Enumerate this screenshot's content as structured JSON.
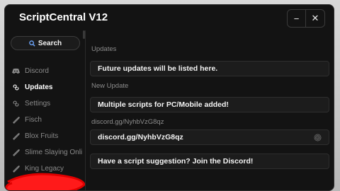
{
  "window": {
    "title": "ScriptCentral V12"
  },
  "controls": {
    "minimize_glyph": "−",
    "close_glyph": "✕"
  },
  "search": {
    "label": "Search"
  },
  "sidebar": {
    "items": [
      {
        "label": "Discord",
        "icon": "discord-icon",
        "active": false
      },
      {
        "label": "Updates",
        "icon": "updates-icon",
        "active": true
      },
      {
        "label": "Settings",
        "icon": "settings-icon",
        "active": false
      },
      {
        "label": "Fisch",
        "icon": "script-icon",
        "active": false
      },
      {
        "label": "Blox Fruits",
        "icon": "script-icon",
        "active": false
      },
      {
        "label": "Slime Slaying Onli",
        "icon": "script-icon",
        "active": false
      },
      {
        "label": "King Legacy",
        "icon": "script-icon",
        "active": false
      }
    ]
  },
  "main": {
    "section_updates": "Updates",
    "card_future": "Future updates will be listed here.",
    "section_new_update": "New Update",
    "card_new": "Multiple scripts for PC/Mobile added!",
    "section_discord": "discord.gg/NyhbVzG8qz",
    "card_discord": "discord.gg/NyhbVzG8qz",
    "card_suggestion": "Have a script suggestion? Join the Discord!"
  },
  "colors": {
    "window_bg": "#131313",
    "card_bg": "#1c1c1c",
    "redaction": "#ff1a1a"
  }
}
